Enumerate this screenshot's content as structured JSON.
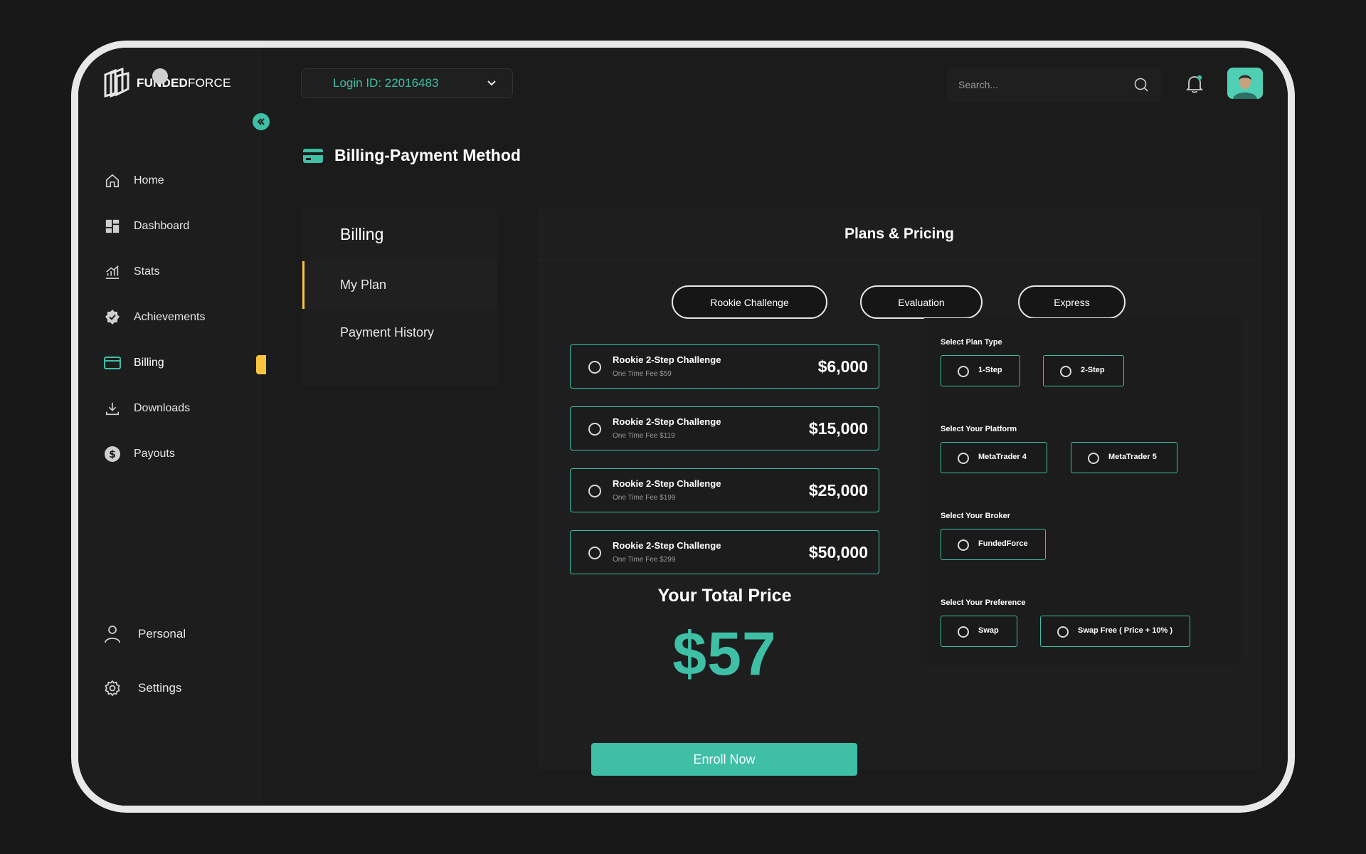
{
  "brand": {
    "logo_bold": "FUNDED",
    "logo_light": "FORCE"
  },
  "sidebar": {
    "items": [
      {
        "label": "Home",
        "icon": "home-icon"
      },
      {
        "label": "Dashboard",
        "icon": "dashboard-icon"
      },
      {
        "label": "Stats",
        "icon": "stats-icon"
      },
      {
        "label": "Achievements",
        "icon": "achievements-icon"
      },
      {
        "label": "Billing",
        "icon": "billing-icon",
        "active": true
      },
      {
        "label": "Downloads",
        "icon": "download-icon"
      },
      {
        "label": "Payouts",
        "icon": "dollar-icon"
      }
    ],
    "bottom": [
      {
        "label": "Personal",
        "icon": "user-icon"
      },
      {
        "label": "Settings",
        "icon": "gear-icon"
      }
    ]
  },
  "topbar": {
    "login_id": "Login ID: 22016483",
    "search_placeholder": "Search..."
  },
  "page": {
    "title": "Billing-Payment Method"
  },
  "billing_menu": {
    "title": "Billing",
    "items": [
      "My Plan",
      "Payment History"
    ],
    "active": "My Plan"
  },
  "plans": {
    "title": "Plans & Pricing",
    "tabs": [
      "Rookie Challenge",
      "Evaluation",
      "Express"
    ],
    "options": [
      {
        "name": "Rookie 2-Step Challenge",
        "fee": "One Time Fee $59",
        "price": "$6,000"
      },
      {
        "name": "Rookie 2-Step Challenge",
        "fee": "One Time Fee $119",
        "price": "$15,000"
      },
      {
        "name": "Rookie 2-Step Challenge",
        "fee": "One Time Fee $199",
        "price": "$25,000"
      },
      {
        "name": "Rookie 2-Step Challenge",
        "fee": "One Time Fee $299",
        "price": "$50,000"
      }
    ],
    "total_label": "Your Total Price",
    "total_value": "$57",
    "enroll_label": "Enroll Now"
  },
  "selectors": {
    "plan_type": {
      "label": "Select Plan Type",
      "options": [
        "1-Step",
        "2-Step"
      ]
    },
    "platform": {
      "label": "Select Your Platform",
      "options": [
        "MetaTrader 4",
        "MetaTrader 5"
      ]
    },
    "broker": {
      "label": "Select Your Broker",
      "options": [
        "FundedForce"
      ]
    },
    "preference": {
      "label": "Select Your Preference",
      "options": [
        "Swap",
        "Swap Free ( Price + 10% )"
      ]
    }
  },
  "colors": {
    "accent": "#3ebfa6",
    "active_flag": "#f8c43d",
    "background": "#1b1b1b"
  }
}
